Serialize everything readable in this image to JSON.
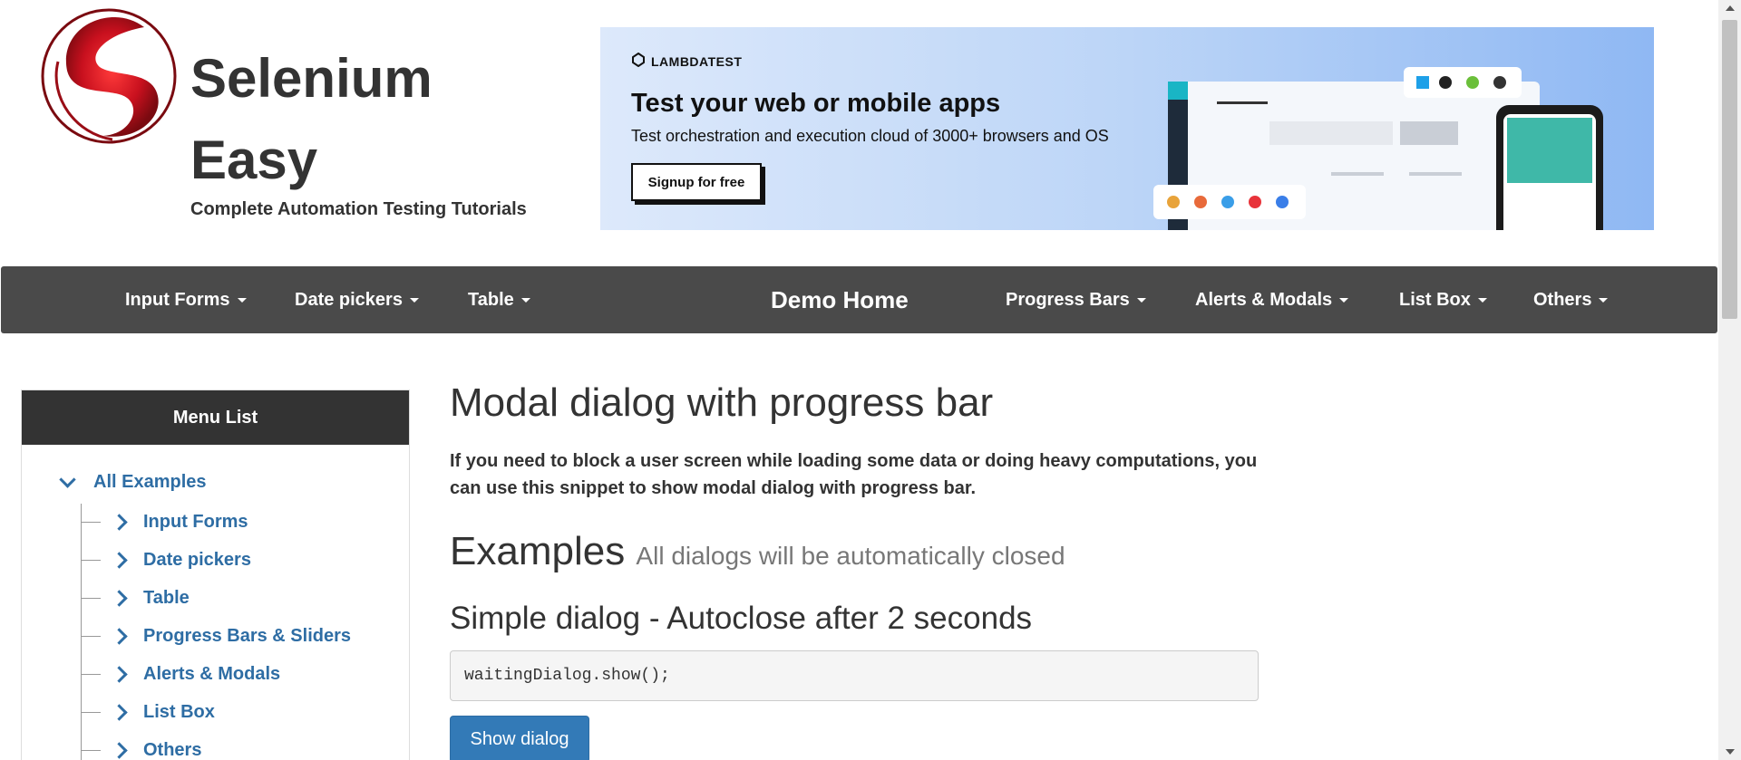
{
  "header": {
    "title_line1": "Selenium",
    "title_line2": "Easy",
    "subtitle": "Complete Automation Testing Tutorials",
    "logo_icon": "selenium-easy-logo"
  },
  "banner": {
    "brand": "LAMBDATEST",
    "headline": "Test your web or mobile apps",
    "subtext": "Test orchestration and execution cloud of 3000+ browsers and OS",
    "cta": "Signup for free"
  },
  "nav": {
    "input_forms": "Input Forms",
    "date_pickers": "Date pickers",
    "table": "Table",
    "demo_home": "Demo Home",
    "progress_bars": "Progress Bars",
    "alerts_modals": "Alerts & Modals",
    "list_box": "List Box",
    "others": "Others"
  },
  "sidebar": {
    "heading": "Menu List",
    "root": "All Examples",
    "items": [
      "Input Forms",
      "Date pickers",
      "Table",
      "Progress Bars & Sliders",
      "Alerts & Modals",
      "List Box",
      "Others"
    ]
  },
  "main": {
    "title": "Modal dialog with progress bar",
    "lead": "If you need to block a user screen while loading some data or doing heavy computations, you can use this snippet to show modal dialog with progress bar.",
    "examples_title": "Examples",
    "examples_note": "All dialogs will be automatically closed",
    "simple_title": "Simple dialog - Autoclose after 2 seconds",
    "code": "waitingDialog.show();",
    "button": "Show dialog"
  },
  "colors": {
    "nav_bg": "#4a4a4a",
    "link": "#2e6da4",
    "primary_button": "#337ab7",
    "sidebar_head": "#333333"
  }
}
